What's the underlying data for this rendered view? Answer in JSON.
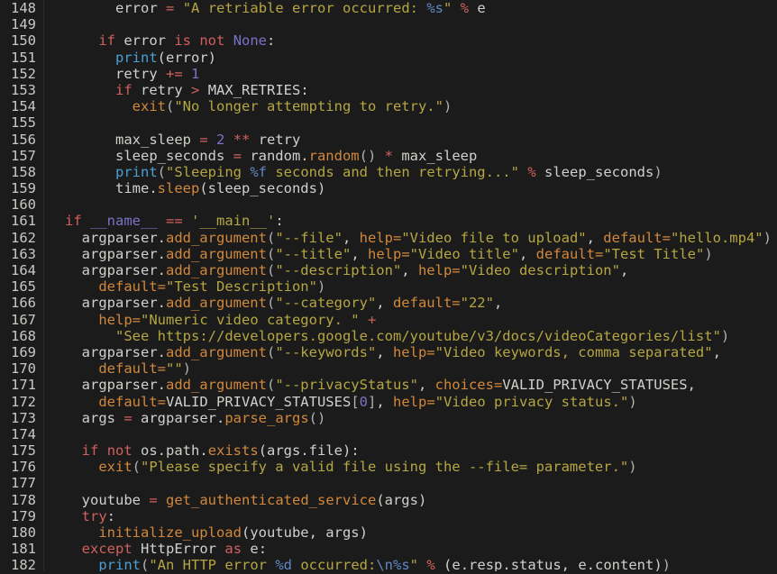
{
  "editor": {
    "language": "python",
    "first_line_number": 148,
    "last_line_number": 182,
    "background_color": "#1b1b1b",
    "gutter_color": "#c7c9c4",
    "colors": {
      "keyword": "#d0605e",
      "function": "#d1883c",
      "builtin": "#4a9fd4",
      "string": "#b5a642",
      "number": "#7a72c7",
      "plain": "#cfd1cc",
      "format_spec": "#5f88c4",
      "dunder": "#7a72c7"
    }
  },
  "lines": [
    {
      "n": "148",
      "text": "      error = \"A retriable error occurred: %s\" % e"
    },
    {
      "n": "149",
      "text": ""
    },
    {
      "n": "150",
      "text": "    if error is not None:"
    },
    {
      "n": "151",
      "text": "      print(error)"
    },
    {
      "n": "152",
      "text": "      retry += 1"
    },
    {
      "n": "153",
      "text": "      if retry > MAX_RETRIES:"
    },
    {
      "n": "154",
      "text": "        exit(\"No longer attempting to retry.\")"
    },
    {
      "n": "155",
      "text": ""
    },
    {
      "n": "156",
      "text": "      max_sleep = 2 ** retry"
    },
    {
      "n": "157",
      "text": "      sleep_seconds = random.random() * max_sleep"
    },
    {
      "n": "158",
      "text": "      print(\"Sleeping %f seconds and then retrying...\" % sleep_seconds)"
    },
    {
      "n": "159",
      "text": "      time.sleep(sleep_seconds)"
    },
    {
      "n": "160",
      "text": ""
    },
    {
      "n": "161",
      "text": "if __name__ == '__main__':"
    },
    {
      "n": "162",
      "text": "  argparser.add_argument(\"--file\", help=\"Video file to upload\", default=\"hello.mp4\")"
    },
    {
      "n": "163",
      "text": "  argparser.add_argument(\"--title\", help=\"Video title\", default=\"Test Title\")"
    },
    {
      "n": "164",
      "text": "  argparser.add_argument(\"--description\", help=\"Video description\","
    },
    {
      "n": "165",
      "text": "    default=\"Test Description\")"
    },
    {
      "n": "166",
      "text": "  argparser.add_argument(\"--category\", default=\"22\","
    },
    {
      "n": "167",
      "text": "    help=\"Numeric video category. \" +"
    },
    {
      "n": "168",
      "text": "      \"See https://developers.google.com/youtube/v3/docs/videoCategories/list\")"
    },
    {
      "n": "169",
      "text": "  argparser.add_argument(\"--keywords\", help=\"Video keywords, comma separated\","
    },
    {
      "n": "170",
      "text": "    default=\"\")"
    },
    {
      "n": "171",
      "text": "  argparser.add_argument(\"--privacyStatus\", choices=VALID_PRIVACY_STATUSES,"
    },
    {
      "n": "172",
      "text": "    default=VALID_PRIVACY_STATUSES[0], help=\"Video privacy status.\")"
    },
    {
      "n": "173",
      "text": "  args = argparser.parse_args()"
    },
    {
      "n": "174",
      "text": ""
    },
    {
      "n": "175",
      "text": "  if not os.path.exists(args.file):"
    },
    {
      "n": "176",
      "text": "    exit(\"Please specify a valid file using the --file= parameter.\")"
    },
    {
      "n": "177",
      "text": ""
    },
    {
      "n": "178",
      "text": "  youtube = get_authenticated_service(args)"
    },
    {
      "n": "179",
      "text": "  try:"
    },
    {
      "n": "180",
      "text": "    initialize_upload(youtube, args)"
    },
    {
      "n": "181",
      "text": "  except HttpError as e:"
    },
    {
      "n": "182",
      "text": "    print(\"An HTTP error %d occurred:\\n%s\" % (e.resp.status, e.content))"
    }
  ],
  "tokens": [
    [
      [
        "      ",
        "plain"
      ],
      [
        "error",
        "plain"
      ],
      [
        " ",
        "plain"
      ],
      [
        "=",
        "opred"
      ],
      [
        " ",
        "plain"
      ],
      [
        "\"A retriable error occurred: ",
        "str"
      ],
      [
        "%s",
        "fmt"
      ],
      [
        "\"",
        "str"
      ],
      [
        " ",
        "plain"
      ],
      [
        "%",
        "opred"
      ],
      [
        " e",
        "plain"
      ]
    ],
    [],
    [
      [
        "    ",
        "plain"
      ],
      [
        "if",
        "kw"
      ],
      [
        " error ",
        "plain"
      ],
      [
        "is",
        "kw"
      ],
      [
        " ",
        "plain"
      ],
      [
        "not",
        "kw"
      ],
      [
        " ",
        "plain"
      ],
      [
        "None",
        "dunder"
      ],
      [
        ":",
        "plain"
      ]
    ],
    [
      [
        "      ",
        "plain"
      ],
      [
        "print",
        "builtin"
      ],
      [
        "(error)",
        "plain"
      ]
    ],
    [
      [
        "      retry ",
        "plain"
      ],
      [
        "+=",
        "opred"
      ],
      [
        " ",
        "plain"
      ],
      [
        "1",
        "num"
      ]
    ],
    [
      [
        "      ",
        "plain"
      ],
      [
        "if",
        "kw"
      ],
      [
        " retry ",
        "plain"
      ],
      [
        ">",
        "opred"
      ],
      [
        " ",
        "plain"
      ],
      [
        "MAX_RETRIES",
        "const"
      ],
      [
        ":",
        "plain"
      ]
    ],
    [
      [
        "        ",
        "plain"
      ],
      [
        "exit",
        "fn"
      ],
      [
        "(",
        "punct"
      ],
      [
        "\"No longer attempting to retry.\"",
        "str"
      ],
      [
        ")",
        "punct"
      ]
    ],
    [],
    [
      [
        "      max_sleep ",
        "plain"
      ],
      [
        "=",
        "opred"
      ],
      [
        " ",
        "plain"
      ],
      [
        "2",
        "num"
      ],
      [
        " ",
        "plain"
      ],
      [
        "**",
        "opred"
      ],
      [
        " retry",
        "plain"
      ]
    ],
    [
      [
        "      sleep_seconds ",
        "plain"
      ],
      [
        "=",
        "opred"
      ],
      [
        " random.",
        "plain"
      ],
      [
        "random",
        "fn"
      ],
      [
        "()",
        "punct"
      ],
      [
        " ",
        "plain"
      ],
      [
        "*",
        "opred"
      ],
      [
        " max_sleep",
        "plain"
      ]
    ],
    [
      [
        "      ",
        "plain"
      ],
      [
        "print",
        "builtin"
      ],
      [
        "(",
        "punct"
      ],
      [
        "\"Sleeping ",
        "str"
      ],
      [
        "%f",
        "fmt"
      ],
      [
        " seconds and then retrying...\"",
        "str"
      ],
      [
        " ",
        "plain"
      ],
      [
        "%",
        "opred"
      ],
      [
        " sleep_seconds",
        "plain"
      ],
      [
        ")",
        "punct"
      ]
    ],
    [
      [
        "      time.",
        "plain"
      ],
      [
        "sleep",
        "fn"
      ],
      [
        "(sleep_seconds)",
        "plain"
      ]
    ],
    [],
    [
      [
        "if",
        "kw"
      ],
      [
        " ",
        "plain"
      ],
      [
        "__name__",
        "dunder"
      ],
      [
        " ",
        "plain"
      ],
      [
        "==",
        "opred"
      ],
      [
        " ",
        "plain"
      ],
      [
        "'__main__'",
        "str"
      ],
      [
        ":",
        "plain"
      ]
    ],
    [
      [
        "  argparser.",
        "plain"
      ],
      [
        "add_argument",
        "fn"
      ],
      [
        "(",
        "punct"
      ],
      [
        "\"--file\"",
        "str"
      ],
      [
        ", ",
        "plain"
      ],
      [
        "help",
        "kwarg"
      ],
      [
        "=",
        "kwarg"
      ],
      [
        "\"Video file to upload\"",
        "str"
      ],
      [
        ", ",
        "plain"
      ],
      [
        "default",
        "kwarg"
      ],
      [
        "=",
        "kwarg"
      ],
      [
        "\"hello.mp4\"",
        "str"
      ],
      [
        ")",
        "punct"
      ]
    ],
    [
      [
        "  argparser.",
        "plain"
      ],
      [
        "add_argument",
        "fn"
      ],
      [
        "(",
        "punct"
      ],
      [
        "\"--title\"",
        "str"
      ],
      [
        ", ",
        "plain"
      ],
      [
        "help",
        "kwarg"
      ],
      [
        "=",
        "kwarg"
      ],
      [
        "\"Video title\"",
        "str"
      ],
      [
        ", ",
        "plain"
      ],
      [
        "default",
        "kwarg"
      ],
      [
        "=",
        "kwarg"
      ],
      [
        "\"Test Title\"",
        "str"
      ],
      [
        ")",
        "punct"
      ]
    ],
    [
      [
        "  argparser.",
        "plain"
      ],
      [
        "add_argument",
        "fn"
      ],
      [
        "(",
        "punct"
      ],
      [
        "\"--description\"",
        "str"
      ],
      [
        ", ",
        "plain"
      ],
      [
        "help",
        "kwarg"
      ],
      [
        "=",
        "kwarg"
      ],
      [
        "\"Video description\"",
        "str"
      ],
      [
        ",",
        "plain"
      ]
    ],
    [
      [
        "    ",
        "plain"
      ],
      [
        "default",
        "kwarg"
      ],
      [
        "=",
        "kwarg"
      ],
      [
        "\"Test Description\"",
        "str"
      ],
      [
        ")",
        "punct"
      ]
    ],
    [
      [
        "  argparser.",
        "plain"
      ],
      [
        "add_argument",
        "fn"
      ],
      [
        "(",
        "punct"
      ],
      [
        "\"--category\"",
        "str"
      ],
      [
        ", ",
        "plain"
      ],
      [
        "default",
        "kwarg"
      ],
      [
        "=",
        "kwarg"
      ],
      [
        "\"22\"",
        "str"
      ],
      [
        ",",
        "plain"
      ]
    ],
    [
      [
        "    ",
        "plain"
      ],
      [
        "help",
        "kwarg"
      ],
      [
        "=",
        "kwarg"
      ],
      [
        "\"Numeric video category. \"",
        "str"
      ],
      [
        " ",
        "plain"
      ],
      [
        "+",
        "opred"
      ]
    ],
    [
      [
        "      ",
        "plain"
      ],
      [
        "\"See https://developers.google.com/youtube/v3/docs/videoCategories/list\"",
        "str"
      ],
      [
        ")",
        "punct"
      ]
    ],
    [
      [
        "  argparser.",
        "plain"
      ],
      [
        "add_argument",
        "fn"
      ],
      [
        "(",
        "punct"
      ],
      [
        "\"--keywords\"",
        "str"
      ],
      [
        ", ",
        "plain"
      ],
      [
        "help",
        "kwarg"
      ],
      [
        "=",
        "kwarg"
      ],
      [
        "\"Video keywords, comma separated\"",
        "str"
      ],
      [
        ",",
        "plain"
      ]
    ],
    [
      [
        "    ",
        "plain"
      ],
      [
        "default",
        "kwarg"
      ],
      [
        "=",
        "kwarg"
      ],
      [
        "\"\"",
        "str"
      ],
      [
        ")",
        "punct"
      ]
    ],
    [
      [
        "  argparser.",
        "plain"
      ],
      [
        "add_argument",
        "fn"
      ],
      [
        "(",
        "punct"
      ],
      [
        "\"--privacyStatus\"",
        "str"
      ],
      [
        ", ",
        "plain"
      ],
      [
        "choices",
        "kwarg"
      ],
      [
        "=",
        "kwarg"
      ],
      [
        "VALID_PRIVACY_STATUSES",
        "const"
      ],
      [
        ",",
        "plain"
      ]
    ],
    [
      [
        "    ",
        "plain"
      ],
      [
        "default",
        "kwarg"
      ],
      [
        "=",
        "kwarg"
      ],
      [
        "VALID_PRIVACY_STATUSES",
        "const"
      ],
      [
        "[",
        "punct"
      ],
      [
        "0",
        "num"
      ],
      [
        "]",
        "punct"
      ],
      [
        ", ",
        "plain"
      ],
      [
        "help",
        "kwarg"
      ],
      [
        "=",
        "kwarg"
      ],
      [
        "\"Video privacy status.\"",
        "str"
      ],
      [
        ")",
        "punct"
      ]
    ],
    [
      [
        "  args ",
        "plain"
      ],
      [
        "=",
        "opred"
      ],
      [
        " argparser.",
        "plain"
      ],
      [
        "parse_args",
        "fn"
      ],
      [
        "()",
        "punct"
      ]
    ],
    [],
    [
      [
        "  ",
        "plain"
      ],
      [
        "if",
        "kw"
      ],
      [
        " ",
        "plain"
      ],
      [
        "not",
        "kw"
      ],
      [
        " os.path.",
        "plain"
      ],
      [
        "exists",
        "fn"
      ],
      [
        "(args.file)",
        "plain"
      ],
      [
        ":",
        "plain"
      ]
    ],
    [
      [
        "    ",
        "plain"
      ],
      [
        "exit",
        "fn"
      ],
      [
        "(",
        "punct"
      ],
      [
        "\"Please specify a valid file using the --file= parameter.\"",
        "str"
      ],
      [
        ")",
        "punct"
      ]
    ],
    [],
    [
      [
        "  youtube ",
        "plain"
      ],
      [
        "=",
        "opred"
      ],
      [
        " ",
        "plain"
      ],
      [
        "get_authenticated_service",
        "fn"
      ],
      [
        "(args)",
        "plain"
      ]
    ],
    [
      [
        "  ",
        "plain"
      ],
      [
        "try",
        "kw"
      ],
      [
        ":",
        "plain"
      ]
    ],
    [
      [
        "    ",
        "plain"
      ],
      [
        "initialize_upload",
        "fn"
      ],
      [
        "(youtube, args)",
        "plain"
      ]
    ],
    [
      [
        "  ",
        "plain"
      ],
      [
        "except",
        "kw"
      ],
      [
        " ",
        "plain"
      ],
      [
        "HttpError",
        "const"
      ],
      [
        " ",
        "plain"
      ],
      [
        "as",
        "kw"
      ],
      [
        " e:",
        "plain"
      ]
    ],
    [
      [
        "    ",
        "plain"
      ],
      [
        "print",
        "builtin"
      ],
      [
        "(",
        "punct"
      ],
      [
        "\"An HTTP error ",
        "str"
      ],
      [
        "%d",
        "fmt"
      ],
      [
        " occurred:",
        "str"
      ],
      [
        "\\n",
        "fmt"
      ],
      [
        "%s",
        "fmt"
      ],
      [
        "\"",
        "str"
      ],
      [
        " ",
        "plain"
      ],
      [
        "%",
        "opred"
      ],
      [
        " (e.resp.status, e.content)",
        "plain"
      ],
      [
        ")",
        "punct"
      ]
    ]
  ]
}
